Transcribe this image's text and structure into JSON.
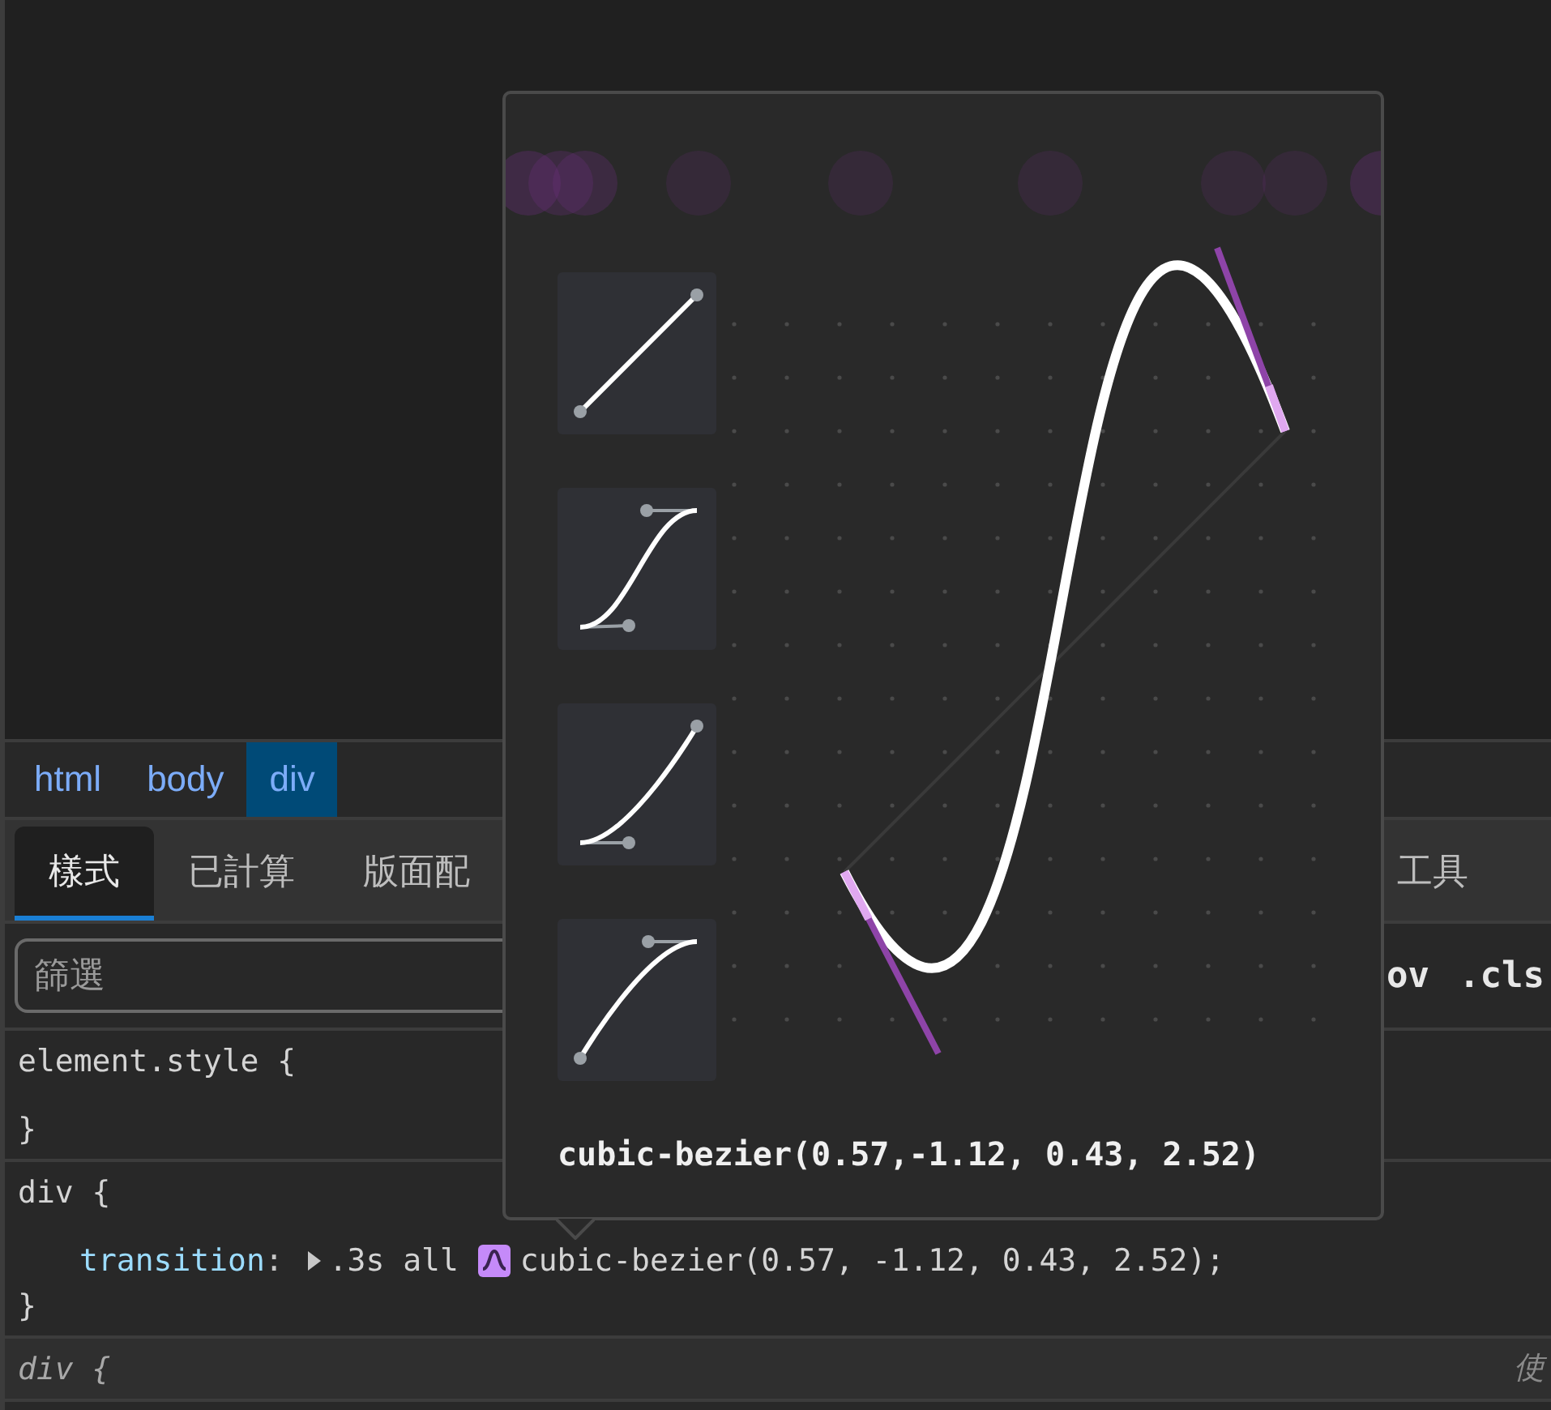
{
  "breadcrumbs": [
    {
      "label": "html",
      "selected": false
    },
    {
      "label": "body",
      "selected": false
    },
    {
      "label": "div",
      "selected": true
    }
  ],
  "tabs": [
    {
      "label": "樣式",
      "selected": true
    },
    {
      "label": "已計算",
      "selected": false
    },
    {
      "label": "版面配",
      "selected": false
    },
    {
      "label": "工具",
      "selected": false
    }
  ],
  "filter": {
    "placeholder": "篩選"
  },
  "filter_buttons": [
    "ov",
    ".cls"
  ],
  "rules": [
    {
      "kind": "element",
      "selector": "element.style {",
      "close": "}"
    },
    {
      "kind": "author",
      "selector": "div {",
      "declarations": [
        {
          "property": "transition",
          "separator": ":",
          "duration": ".3s all",
          "timing": "cubic-bezier(0.57, -1.12, 0.43, 2.52);"
        }
      ],
      "close": "}"
    },
    {
      "kind": "user_agent",
      "selector": "div {",
      "source": "使"
    }
  ],
  "bezier_popover": {
    "presets": [
      {
        "kind": "linear"
      },
      {
        "kind": "ease-in-out"
      },
      {
        "kind": "ease-in"
      },
      {
        "kind": "ease-out"
      }
    ],
    "value": "cubic-bezier(0.57,-1.12, 0.43, 2.52)"
  }
}
